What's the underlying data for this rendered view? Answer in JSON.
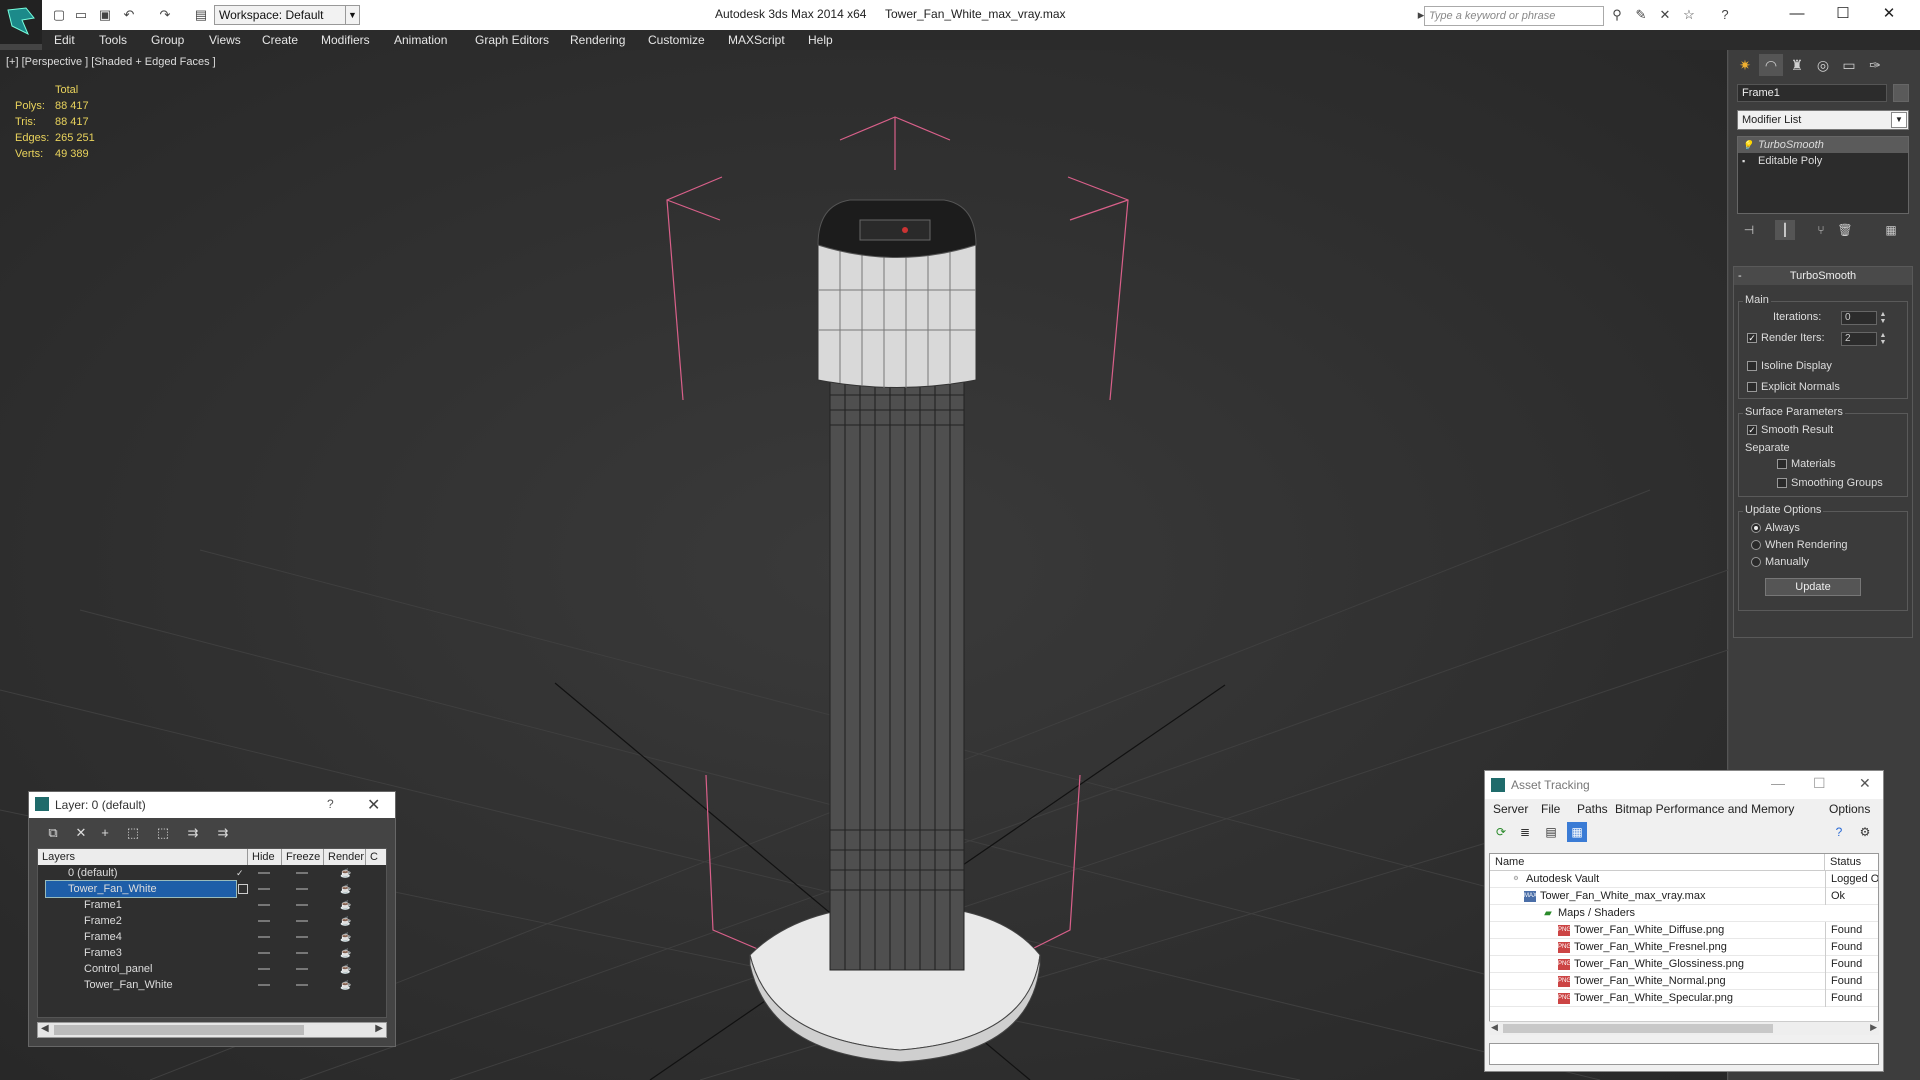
{
  "titlebar": {
    "app_title": "Autodesk 3ds Max  2014 x64",
    "file_title": "Tower_Fan_White_max_vray.max",
    "workspace": "Workspace: Default",
    "search_placeholder": "Type a keyword or phrase"
  },
  "menu": [
    "Edit",
    "Tools",
    "Group",
    "Views",
    "Create",
    "Modifiers",
    "Animation",
    "Graph Editors",
    "Rendering",
    "Customize",
    "MAXScript",
    "Help"
  ],
  "viewport": {
    "label": "[+] [Perspective ] [Shaded + Edged Faces ]",
    "stats_header": "Total",
    "stats": [
      {
        "key": "Polys:",
        "value": "88 417"
      },
      {
        "key": "Tris:",
        "value": "88 417"
      },
      {
        "key": "Edges:",
        "value": "265 251"
      },
      {
        "key": "Verts:",
        "value": "49 389"
      }
    ]
  },
  "command_panel": {
    "object_name": "Frame1",
    "modifier_list": "Modifier List",
    "stack": [
      "TurboSmooth",
      "Editable Poly"
    ],
    "rollout_title": "TurboSmooth",
    "main_label": "Main",
    "iterations_label": "Iterations:",
    "iterations_value": "0",
    "render_iters_label": "Render Iters:",
    "render_iters_value": "2",
    "isoline_label": "Isoline Display",
    "explicit_label": "Explicit Normals",
    "surface_label": "Surface Parameters",
    "smooth_label": "Smooth Result",
    "separate_label": "Separate",
    "materials_label": "Materials",
    "smoothing_groups_label": "Smoothing Groups",
    "update_options_label": "Update Options",
    "always_label": "Always",
    "when_rendering_label": "When Rendering",
    "manually_label": "Manually",
    "update_button": "Update"
  },
  "layer_dialog": {
    "title": "Layer: 0 (default)",
    "help": "?",
    "columns": {
      "layers": "Layers",
      "hide": "Hide",
      "freeze": "Freeze",
      "render": "Render",
      "c": "C"
    },
    "rows": [
      "0 (default)",
      "Tower_Fan_White",
      "Frame1",
      "Frame2",
      "Frame4",
      "Frame3",
      "Control_panel",
      "Tower_Fan_White"
    ]
  },
  "asset_dialog": {
    "title": "Asset Tracking",
    "menu": [
      "Server",
      "File",
      "Paths",
      "Bitmap Performance and Memory",
      "Options"
    ],
    "col_name": "Name",
    "col_status": "Status",
    "rows": [
      {
        "name": "Autodesk Vault",
        "status": "Logged O"
      },
      {
        "name": "Tower_Fan_White_max_vray.max",
        "status": "Ok"
      },
      {
        "name": "Maps / Shaders",
        "status": ""
      },
      {
        "name": "Tower_Fan_White_Diffuse.png",
        "status": "Found"
      },
      {
        "name": "Tower_Fan_White_Fresnel.png",
        "status": "Found"
      },
      {
        "name": "Tower_Fan_White_Glossiness.png",
        "status": "Found"
      },
      {
        "name": "Tower_Fan_White_Normal.png",
        "status": "Found"
      },
      {
        "name": "Tower_Fan_White_Specular.png",
        "status": "Found"
      }
    ]
  }
}
